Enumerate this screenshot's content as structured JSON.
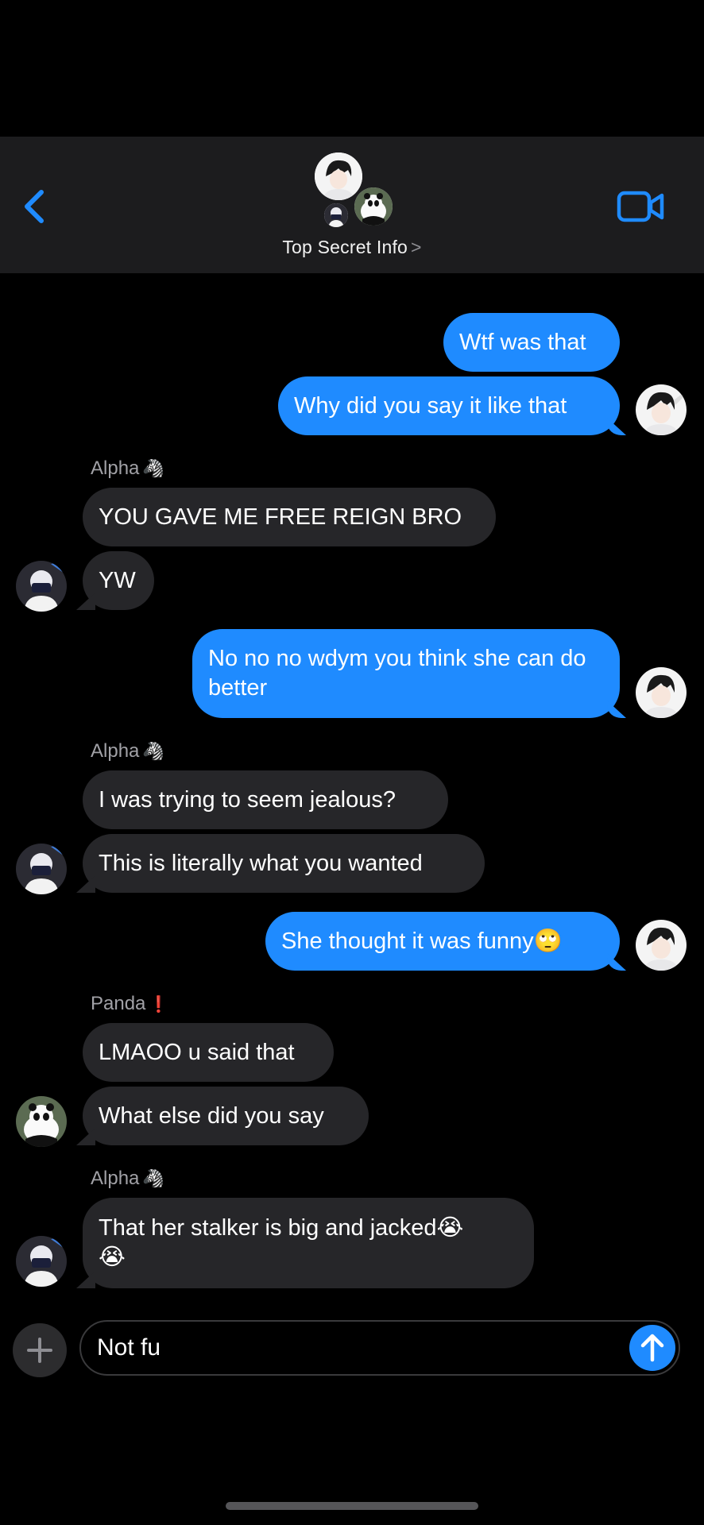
{
  "header": {
    "group_name": "Top Secret Info",
    "chevron": ">",
    "back_icon": "chevron-left-icon",
    "video_icon": "video-camera-icon",
    "accent": "#1f8bff"
  },
  "messages": [
    {
      "direction": "out",
      "text": "Wtf was that"
    },
    {
      "direction": "out",
      "text": "Why did you say it like that"
    },
    {
      "sender": "Alpha",
      "sender_emoji": "🦓",
      "direction": "in",
      "text": "YOU GAVE ME FREE REIGN BRO"
    },
    {
      "direction": "in",
      "text": "YW"
    },
    {
      "direction": "out",
      "text": "No no no wdym you think she can do better"
    },
    {
      "sender": "Alpha",
      "sender_emoji": "🦓",
      "direction": "in",
      "text": "I was trying to seem jealous?"
    },
    {
      "direction": "in",
      "text": "This is literally what you wanted"
    },
    {
      "direction": "out",
      "text": "She thought it was funny🙄"
    },
    {
      "sender": "Panda",
      "sender_emoji": "❗",
      "direction": "in",
      "text": "LMAOO u said that"
    },
    {
      "direction": "in",
      "text": "What else did you say"
    },
    {
      "sender": "Alpha",
      "sender_emoji": "🦓",
      "direction": "in",
      "text": "That her stalker is big and jacked😭 😭"
    }
  ],
  "composer": {
    "value": "Not fu",
    "plus_icon": "plus-icon",
    "send_icon": "arrow-up-icon"
  },
  "colors": {
    "outgoing_bubble": "#1f8bff",
    "incoming_bubble": "#262629",
    "background": "#000000"
  }
}
